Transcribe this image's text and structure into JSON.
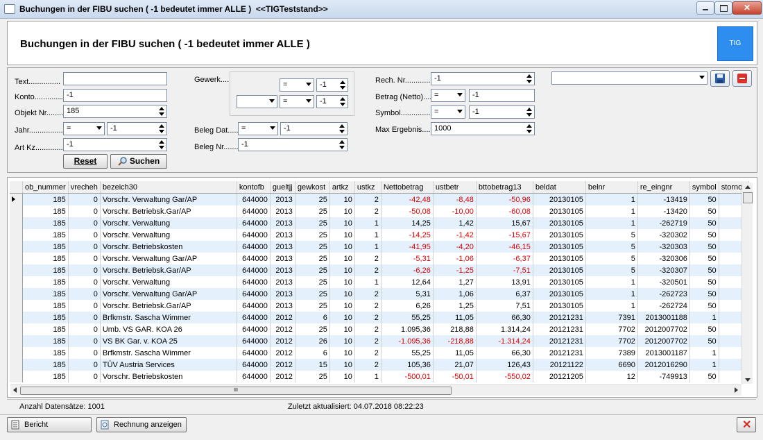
{
  "window": {
    "title": "Buchungen in der FIBU suchen ( -1 bedeutet immer ALLE )  <<TIGTeststand>>"
  },
  "header": {
    "title": "Buchungen in der FIBU suchen ( -1 bedeutet immer ALLE )",
    "logo_text": "TIG"
  },
  "filters": {
    "text_label": "Text...............",
    "text_value": "",
    "konto_label": "Konto..............",
    "konto_value": "-1",
    "objekt_label": "Objekt Nr........",
    "objekt_value": "185",
    "jahr_label": "Jahr..................",
    "jahr_op": "=",
    "jahr_value": "-1",
    "artkz_label": "Art Kz..............",
    "artkz_value": "-1",
    "gewerk_label": "Gewerk....",
    "gewerk_op1": "=",
    "gewerk_val1": "-1",
    "gewerk_sel2": "",
    "gewerk_op2": "=",
    "gewerk_val2": "-1",
    "belegdat_label": "Beleg Dat.....",
    "belegdat_op": "=",
    "belegdat_value": "-1",
    "belegnr_label": "Beleg Nr.......",
    "belegnr_value": "-1",
    "rechnr_label": "Rech. Nr.............",
    "rechnr_value": "-1",
    "betrag_label": "Betrag (Netto)....",
    "betrag_op": "=",
    "betrag_value": "-1",
    "symbol_label": "Symbol...............",
    "symbol_op": "=",
    "symbol_value": "-1",
    "max_label": "Max Ergebnis......",
    "max_value": "1000",
    "preset_value": "",
    "reset_label": "Reset",
    "search_label": "Suchen"
  },
  "table": {
    "columns": [
      "ob_nummer",
      "vrecheh",
      "bezeich30",
      "kontofb",
      "gueltjj",
      "gewkost",
      "artkz",
      "ustkz",
      "Nettobetrag",
      "ustbetr",
      "bttobetrag13",
      "beldat",
      "belnr",
      "re_eingnr",
      "symbol",
      "stornok"
    ],
    "rows": [
      [
        "185",
        "0",
        "Vorschr.  Verwaltung Gar/AP",
        "644000",
        "2013",
        "25",
        "10",
        "2",
        "-42,48",
        "-8,48",
        "-50,96",
        "20130105",
        "1",
        "-13419",
        "50",
        ""
      ],
      [
        "185",
        "0",
        "Vorschr.  Betriebsk.Gar/AP",
        "644000",
        "2013",
        "25",
        "10",
        "2",
        "-50,08",
        "-10,00",
        "-60,08",
        "20130105",
        "1",
        "-13420",
        "50",
        ""
      ],
      [
        "185",
        "0",
        "Vorschr.  Verwaltung",
        "644000",
        "2013",
        "25",
        "10",
        "1",
        "14,25",
        "1,42",
        "15,67",
        "20130105",
        "1",
        "-262719",
        "50",
        ""
      ],
      [
        "185",
        "0",
        "Vorschr.  Verwaltung",
        "644000",
        "2013",
        "25",
        "10",
        "1",
        "-14,25",
        "-1,42",
        "-15,67",
        "20130105",
        "5",
        "-320302",
        "50",
        ""
      ],
      [
        "185",
        "0",
        "Vorschr.  Betriebskosten",
        "644000",
        "2013",
        "25",
        "10",
        "1",
        "-41,95",
        "-4,20",
        "-46,15",
        "20130105",
        "5",
        "-320303",
        "50",
        ""
      ],
      [
        "185",
        "0",
        "Vorschr.  Verwaltung Gar/AP",
        "644000",
        "2013",
        "25",
        "10",
        "2",
        "-5,31",
        "-1,06",
        "-6,37",
        "20130105",
        "5",
        "-320306",
        "50",
        ""
      ],
      [
        "185",
        "0",
        "Vorschr.  Betriebsk.Gar/AP",
        "644000",
        "2013",
        "25",
        "10",
        "2",
        "-6,26",
        "-1,25",
        "-7,51",
        "20130105",
        "5",
        "-320307",
        "50",
        ""
      ],
      [
        "185",
        "0",
        "Vorschr.  Verwaltung",
        "644000",
        "2013",
        "25",
        "10",
        "1",
        "12,64",
        "1,27",
        "13,91",
        "20130105",
        "1",
        "-320501",
        "50",
        ""
      ],
      [
        "185",
        "0",
        "Vorschr.  Verwaltung Gar/AP",
        "644000",
        "2013",
        "25",
        "10",
        "2",
        "5,31",
        "1,06",
        "6,37",
        "20130105",
        "1",
        "-262723",
        "50",
        ""
      ],
      [
        "185",
        "0",
        "Vorschr.  Betriebsk.Gar/AP",
        "644000",
        "2013",
        "25",
        "10",
        "2",
        "6,26",
        "1,25",
        "7,51",
        "20130105",
        "1",
        "-262724",
        "50",
        ""
      ],
      [
        "185",
        "0",
        "Brfkmstr. Sascha Wimmer",
        "644000",
        "2012",
        "6",
        "10",
        "2",
        "55,25",
        "11,05",
        "66,30",
        "20121231",
        "7391",
        "2013001188",
        "1",
        ""
      ],
      [
        "185",
        "0",
        "Umb. VS GAR. KOA 26",
        "644000",
        "2012",
        "25",
        "10",
        "2",
        "1.095,36",
        "218,88",
        "1.314,24",
        "20121231",
        "7702",
        "2012007702",
        "50",
        ""
      ],
      [
        "185",
        "0",
        "VS BK Gar. v. KOA 25",
        "644000",
        "2012",
        "26",
        "10",
        "2",
        "-1.095,36",
        "-218,88",
        "-1.314,24",
        "20121231",
        "7702",
        "2012007702",
        "50",
        ""
      ],
      [
        "185",
        "0",
        "Brfkmstr. Sascha Wimmer",
        "644000",
        "2012",
        "6",
        "10",
        "2",
        "55,25",
        "11,05",
        "66,30",
        "20121231",
        "7389",
        "2013001187",
        "1",
        ""
      ],
      [
        "185",
        "0",
        "TÜV Austria Services",
        "644000",
        "2012",
        "15",
        "10",
        "2",
        "105,36",
        "21,07",
        "126,43",
        "20121122",
        "6690",
        "2012016290",
        "1",
        ""
      ],
      [
        "185",
        "0",
        "Vorschr.  Betriebskosten",
        "644000",
        "2012",
        "25",
        "10",
        "1",
        "-500,01",
        "-50,01",
        "-550,02",
        "20121205",
        "12",
        "-749913",
        "50",
        ""
      ]
    ],
    "hscroll_glyph": "III"
  },
  "status": {
    "count": "Anzahl Datensätze: 1001",
    "updated": "Zuletzt aktualisiert: 04.07.2018 08:22:23"
  },
  "bottom": {
    "bericht_label": "Bericht",
    "rechnung_label": "Rechnung anzeigen"
  }
}
